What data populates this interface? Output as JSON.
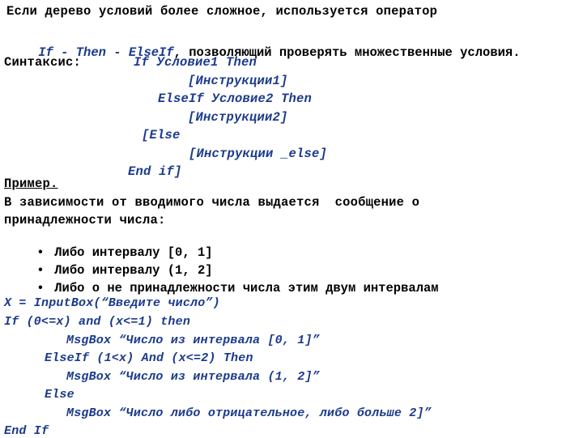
{
  "colors": {
    "background": "#ffffff",
    "prose_text": "#000000",
    "code_text": "#1b3a8c"
  },
  "intro": {
    "line1": "Если дерево условий более сложное, используется оператор",
    "line2_code": "If - Then - ElseIf",
    "line2_rest": ", позволяющий проверять множественные условия."
  },
  "syntax": {
    "label": "Синтаксис:",
    "lines": [
      "If Условие1 Then",
      "[Инструкции1]",
      "ElseIf Условие2 Then",
      "[Инструкции2]",
      "[Else",
      "[Инструкции _else]",
      "End if]"
    ]
  },
  "example": {
    "heading": "Пример.",
    "description_line1": "В зависимости от вводимого числа выдается  сообщение о",
    "description_line2": "принадлежности числа:",
    "bullet_mark": "•",
    "bullets": [
      "Либо интервалу [0, 1]",
      "Либо интервалу (1, 2]",
      "Либо о не принадлежности числа этим двум интервалам"
    ]
  },
  "code": {
    "lines": [
      "X = InputBox(“Введите число”)",
      "If (0<=x) and (x<=1) then",
      "MsgBox “Число из интервала [0, 1]”",
      "ElseIf (1<x) And (x<=2) Then",
      "MsgBox “Число из интервала (1, 2]”",
      "Else",
      "MsgBox “Число либо отрицательное, либо больше 2]”",
      "End If"
    ]
  }
}
